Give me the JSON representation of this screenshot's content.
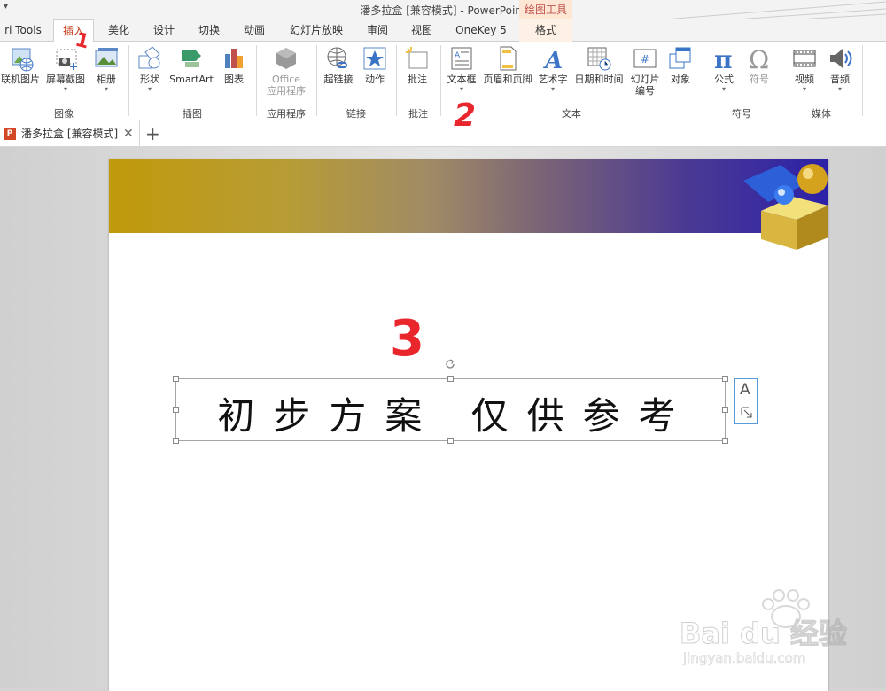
{
  "titlebar": {
    "quick_access": "▾",
    "title": "潘多拉盒 [兼容模式] - PowerPoint",
    "context_label": "绘图工具"
  },
  "tabs": [
    {
      "label": "ri Tools"
    },
    {
      "label": "插入"
    },
    {
      "label": "美化"
    },
    {
      "label": "设计"
    },
    {
      "label": "切换"
    },
    {
      "label": "动画"
    },
    {
      "label": "幻灯片放映"
    },
    {
      "label": "审阅"
    },
    {
      "label": "视图"
    },
    {
      "label": "OneKey 5"
    },
    {
      "label": "格式"
    }
  ],
  "ribbon": {
    "buttons": {
      "online_pic": "联机图片",
      "screenshot": "屏幕截图",
      "album": "相册",
      "shapes": "形状",
      "smartart": "SmartArt",
      "chart": "图表",
      "office_app_1": "Office",
      "office_app_2": "应用程序",
      "hyperlink": "超链接",
      "action": "动作",
      "comment": "批注",
      "textbox": "文本框",
      "header_footer": "页眉和页脚",
      "wordart": "艺术字",
      "datetime": "日期和时间",
      "slide_num_1": "幻灯片",
      "slide_num_2": "编号",
      "object": "对象",
      "equation": "公式",
      "symbol": "符号",
      "video": "视频",
      "audio": "音频"
    },
    "groups": {
      "image": "图像",
      "illustrations": "插图",
      "apps": "应用程序",
      "links": "链接",
      "comments": "批注",
      "text": "文本",
      "symbols": "符号",
      "media": "媒体"
    }
  },
  "document_tab": {
    "icon_text": "P",
    "title": "潘多拉盒 [兼容模式]",
    "close": "✕",
    "new_tab": "+"
  },
  "slide": {
    "text": "初步方案 仅供参考"
  },
  "layout_options": {
    "glyph": "A"
  },
  "annotations": {
    "one": "1",
    "two": "2",
    "three": "3"
  },
  "watermark": {
    "brand": "Bai du 经验",
    "url": "jingyan.baidu.com"
  },
  "colors": {
    "accent": "#c43e1c",
    "annotation": "#e8262c",
    "selection": "#5b9bd5"
  }
}
